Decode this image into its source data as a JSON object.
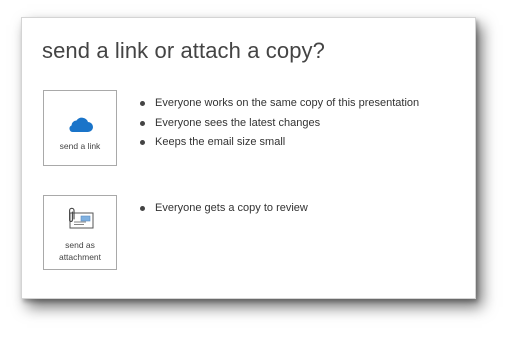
{
  "dialog": {
    "title": "send a link or attach a copy?",
    "options": [
      {
        "icon": "cloud-icon",
        "label": "send a link",
        "bullets": [
          "Everyone works on the same copy of this presentation",
          "Everyone sees the latest changes",
          "Keeps the email size small"
        ]
      },
      {
        "icon": "attachment-envelope-icon",
        "label_line1": "send as",
        "label_line2": "attachment",
        "bullets": [
          "Everyone gets a copy to review"
        ]
      }
    ]
  },
  "colors": {
    "cloud": "#1a74c9",
    "text": "#333333",
    "border": "#a9a9a9"
  }
}
